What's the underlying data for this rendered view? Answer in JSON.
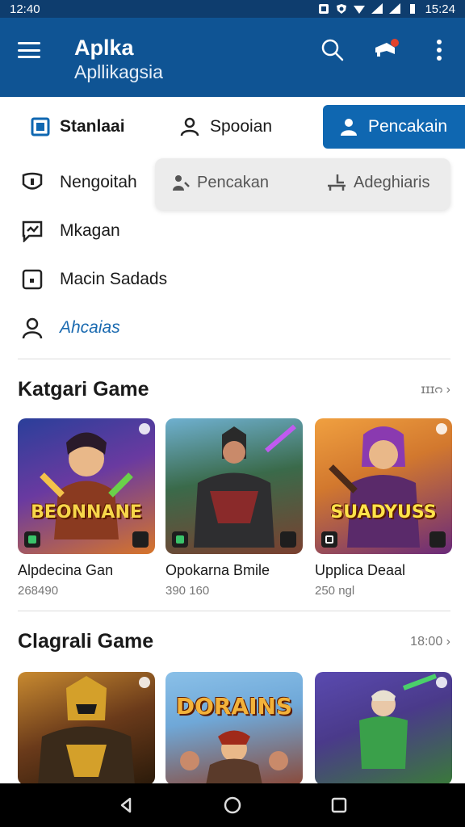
{
  "status": {
    "left_time": "12:40",
    "right_time": "15:24"
  },
  "app": {
    "title": "Aplka",
    "subtitle": "Apllikagsia"
  },
  "tabs": [
    {
      "label": "Stanlaai",
      "icon": "square-icon"
    },
    {
      "label": "Spooian",
      "icon": "person-icon"
    },
    {
      "label": "Pencakain",
      "icon": "person-icon"
    }
  ],
  "menu": [
    {
      "label": "Nengoitah",
      "icon": "shield-icon"
    },
    {
      "label": "Mkagan",
      "icon": "chat-icon"
    },
    {
      "label": "Macin Sadads",
      "icon": "square-dot-icon"
    },
    {
      "label": "Ahcaias",
      "icon": "person-icon"
    }
  ],
  "dropdown": [
    {
      "label": "Pencakan",
      "icon": "user-tool-icon"
    },
    {
      "label": "Adeghiaris",
      "icon": "chair-icon"
    }
  ],
  "sections": [
    {
      "title": "Katgari Game",
      "more": "ɪɪɪᴒ",
      "cards": [
        {
          "title": "Alpdecina Gan",
          "count": "268490",
          "logo": "BEONNANE",
          "colors": [
            "#2a3f9a",
            "#d7752a"
          ]
        },
        {
          "title": "Opokarna Bmile",
          "count": "390 160",
          "logo": "",
          "colors": [
            "#3a6a4a",
            "#7a4030"
          ]
        },
        {
          "title": "Upplica Deaal",
          "count": "250 ngl",
          "logo": "SUADYUSS",
          "colors": [
            "#d2782e",
            "#6a2a7a"
          ]
        }
      ]
    },
    {
      "title": "Clagrali Game",
      "more": "18:00",
      "cards": [
        {
          "title": "",
          "count": "",
          "logo": "",
          "colors": [
            "#3a2a1a",
            "#b86a20"
          ]
        },
        {
          "title": "",
          "count": "",
          "logo": "DORAINS",
          "colors": [
            "#6fa8d8",
            "#8a4a3a"
          ]
        },
        {
          "title": "",
          "count": "",
          "logo": "",
          "colors": [
            "#4a3a8a",
            "#3a7a3a"
          ]
        }
      ]
    }
  ],
  "accent": "#0f67b1",
  "appbar_color": "#0f5494"
}
